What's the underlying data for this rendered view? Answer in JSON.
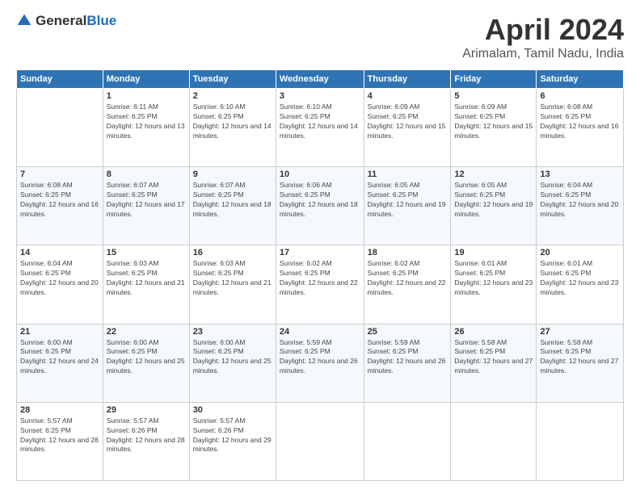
{
  "logo": {
    "text_general": "General",
    "text_blue": "Blue"
  },
  "header": {
    "month": "April 2024",
    "location": "Arimalam, Tamil Nadu, India"
  },
  "weekdays": [
    "Sunday",
    "Monday",
    "Tuesday",
    "Wednesday",
    "Thursday",
    "Friday",
    "Saturday"
  ],
  "weeks": [
    [
      {
        "day": "",
        "sunrise": "",
        "sunset": "",
        "daylight": ""
      },
      {
        "day": "1",
        "sunrise": "Sunrise: 6:11 AM",
        "sunset": "Sunset: 6:25 PM",
        "daylight": "Daylight: 12 hours and 13 minutes."
      },
      {
        "day": "2",
        "sunrise": "Sunrise: 6:10 AM",
        "sunset": "Sunset: 6:25 PM",
        "daylight": "Daylight: 12 hours and 14 minutes."
      },
      {
        "day": "3",
        "sunrise": "Sunrise: 6:10 AM",
        "sunset": "Sunset: 6:25 PM",
        "daylight": "Daylight: 12 hours and 14 minutes."
      },
      {
        "day": "4",
        "sunrise": "Sunrise: 6:09 AM",
        "sunset": "Sunset: 6:25 PM",
        "daylight": "Daylight: 12 hours and 15 minutes."
      },
      {
        "day": "5",
        "sunrise": "Sunrise: 6:09 AM",
        "sunset": "Sunset: 6:25 PM",
        "daylight": "Daylight: 12 hours and 15 minutes."
      },
      {
        "day": "6",
        "sunrise": "Sunrise: 6:08 AM",
        "sunset": "Sunset: 6:25 PM",
        "daylight": "Daylight: 12 hours and 16 minutes."
      }
    ],
    [
      {
        "day": "7",
        "sunrise": "Sunrise: 6:08 AM",
        "sunset": "Sunset: 6:25 PM",
        "daylight": "Daylight: 12 hours and 16 minutes."
      },
      {
        "day": "8",
        "sunrise": "Sunrise: 6:07 AM",
        "sunset": "Sunset: 6:25 PM",
        "daylight": "Daylight: 12 hours and 17 minutes."
      },
      {
        "day": "9",
        "sunrise": "Sunrise: 6:07 AM",
        "sunset": "Sunset: 6:25 PM",
        "daylight": "Daylight: 12 hours and 18 minutes."
      },
      {
        "day": "10",
        "sunrise": "Sunrise: 6:06 AM",
        "sunset": "Sunset: 6:25 PM",
        "daylight": "Daylight: 12 hours and 18 minutes."
      },
      {
        "day": "11",
        "sunrise": "Sunrise: 6:05 AM",
        "sunset": "Sunset: 6:25 PM",
        "daylight": "Daylight: 12 hours and 19 minutes."
      },
      {
        "day": "12",
        "sunrise": "Sunrise: 6:05 AM",
        "sunset": "Sunset: 6:25 PM",
        "daylight": "Daylight: 12 hours and 19 minutes."
      },
      {
        "day": "13",
        "sunrise": "Sunrise: 6:04 AM",
        "sunset": "Sunset: 6:25 PM",
        "daylight": "Daylight: 12 hours and 20 minutes."
      }
    ],
    [
      {
        "day": "14",
        "sunrise": "Sunrise: 6:04 AM",
        "sunset": "Sunset: 6:25 PM",
        "daylight": "Daylight: 12 hours and 20 minutes."
      },
      {
        "day": "15",
        "sunrise": "Sunrise: 6:03 AM",
        "sunset": "Sunset: 6:25 PM",
        "daylight": "Daylight: 12 hours and 21 minutes."
      },
      {
        "day": "16",
        "sunrise": "Sunrise: 6:03 AM",
        "sunset": "Sunset: 6:25 PM",
        "daylight": "Daylight: 12 hours and 21 minutes."
      },
      {
        "day": "17",
        "sunrise": "Sunrise: 6:02 AM",
        "sunset": "Sunset: 6:25 PM",
        "daylight": "Daylight: 12 hours and 22 minutes."
      },
      {
        "day": "18",
        "sunrise": "Sunrise: 6:02 AM",
        "sunset": "Sunset: 6:25 PM",
        "daylight": "Daylight: 12 hours and 22 minutes."
      },
      {
        "day": "19",
        "sunrise": "Sunrise: 6:01 AM",
        "sunset": "Sunset: 6:25 PM",
        "daylight": "Daylight: 12 hours and 23 minutes."
      },
      {
        "day": "20",
        "sunrise": "Sunrise: 6:01 AM",
        "sunset": "Sunset: 6:25 PM",
        "daylight": "Daylight: 12 hours and 23 minutes."
      }
    ],
    [
      {
        "day": "21",
        "sunrise": "Sunrise: 6:00 AM",
        "sunset": "Sunset: 6:25 PM",
        "daylight": "Daylight: 12 hours and 24 minutes."
      },
      {
        "day": "22",
        "sunrise": "Sunrise: 6:00 AM",
        "sunset": "Sunset: 6:25 PM",
        "daylight": "Daylight: 12 hours and 25 minutes."
      },
      {
        "day": "23",
        "sunrise": "Sunrise: 6:00 AM",
        "sunset": "Sunset: 6:25 PM",
        "daylight": "Daylight: 12 hours and 25 minutes."
      },
      {
        "day": "24",
        "sunrise": "Sunrise: 5:59 AM",
        "sunset": "Sunset: 6:25 PM",
        "daylight": "Daylight: 12 hours and 26 minutes."
      },
      {
        "day": "25",
        "sunrise": "Sunrise: 5:59 AM",
        "sunset": "Sunset: 6:25 PM",
        "daylight": "Daylight: 12 hours and 26 minutes."
      },
      {
        "day": "26",
        "sunrise": "Sunrise: 5:58 AM",
        "sunset": "Sunset: 6:25 PM",
        "daylight": "Daylight: 12 hours and 27 minutes."
      },
      {
        "day": "27",
        "sunrise": "Sunrise: 5:58 AM",
        "sunset": "Sunset: 6:25 PM",
        "daylight": "Daylight: 12 hours and 27 minutes."
      }
    ],
    [
      {
        "day": "28",
        "sunrise": "Sunrise: 5:57 AM",
        "sunset": "Sunset: 6:25 PM",
        "daylight": "Daylight: 12 hours and 28 minutes."
      },
      {
        "day": "29",
        "sunrise": "Sunrise: 5:57 AM",
        "sunset": "Sunset: 6:26 PM",
        "daylight": "Daylight: 12 hours and 28 minutes."
      },
      {
        "day": "30",
        "sunrise": "Sunrise: 5:57 AM",
        "sunset": "Sunset: 6:26 PM",
        "daylight": "Daylight: 12 hours and 29 minutes."
      },
      {
        "day": "",
        "sunrise": "",
        "sunset": "",
        "daylight": ""
      },
      {
        "day": "",
        "sunrise": "",
        "sunset": "",
        "daylight": ""
      },
      {
        "day": "",
        "sunrise": "",
        "sunset": "",
        "daylight": ""
      },
      {
        "day": "",
        "sunrise": "",
        "sunset": "",
        "daylight": ""
      }
    ]
  ]
}
